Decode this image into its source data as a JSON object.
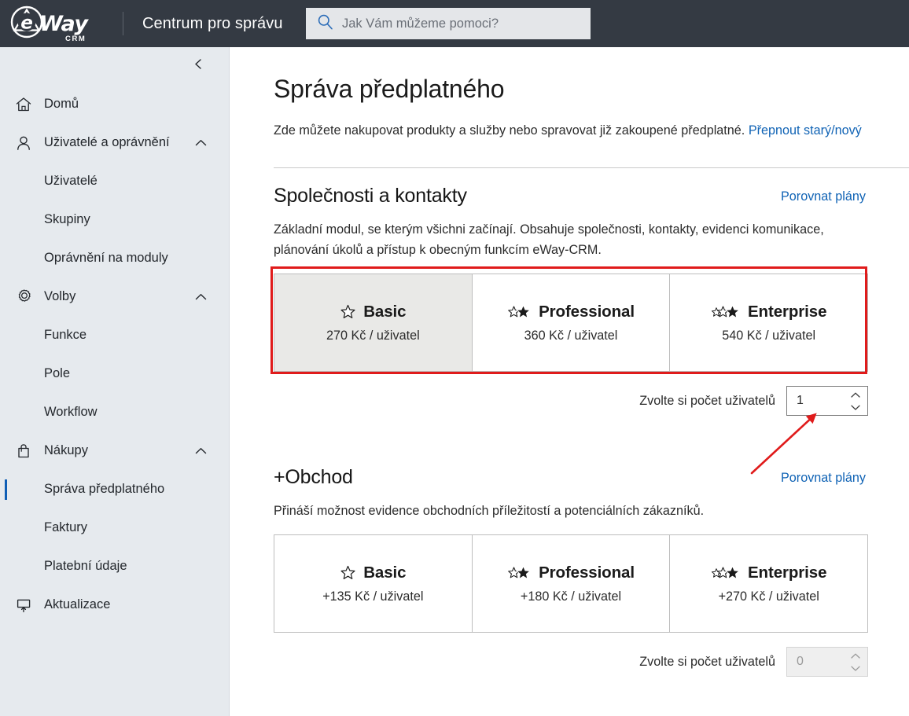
{
  "header": {
    "logo_way": "Way",
    "logo_crm": "CRM",
    "logo_emblem_icon": "eway-circle-e-icon",
    "title": "Centrum pro správu",
    "search": {
      "icon": "search-icon",
      "placeholder": "Jak Vám můžeme pomoci?",
      "value": ""
    }
  },
  "sidebar": {
    "collapse_icon": "chevron-left-icon",
    "items": [
      {
        "label": "Domů",
        "icon": "home-icon",
        "type": "top",
        "expandable": false
      },
      {
        "label": "Uživatelé a oprávnění",
        "icon": "user-icon",
        "type": "top",
        "expandable": true,
        "chevron": "chevron-up-icon"
      },
      {
        "label": "Uživatelé",
        "type": "sub"
      },
      {
        "label": "Skupiny",
        "type": "sub"
      },
      {
        "label": "Oprávnění na moduly",
        "type": "sub"
      },
      {
        "label": "Volby",
        "icon": "gear-icon",
        "type": "top",
        "expandable": true,
        "chevron": "chevron-up-icon"
      },
      {
        "label": "Funkce",
        "type": "sub"
      },
      {
        "label": "Pole",
        "type": "sub"
      },
      {
        "label": "Workflow",
        "type": "sub"
      },
      {
        "label": "Nákupy",
        "icon": "bag-icon",
        "type": "top",
        "expandable": true,
        "chevron": "chevron-up-icon"
      },
      {
        "label": "Správa předplatného",
        "type": "sub",
        "active": true
      },
      {
        "label": "Faktury",
        "type": "sub"
      },
      {
        "label": "Platební údaje",
        "type": "sub"
      },
      {
        "label": "Aktualizace",
        "icon": "monitor-upload-icon",
        "type": "top",
        "expandable": false
      }
    ]
  },
  "main": {
    "page_title": "Správa předplatného",
    "subtitle_text": "Zde můžete nakupovat produkty a služby nebo spravovat již zakoupené předplatné.",
    "subtitle_link": "Přepnout starý/nový",
    "sections": [
      {
        "title": "Společnosti a kontakty",
        "compare_link": "Porovnat plány",
        "description": "Základní modul, se kterým všichni začínají. Obsahuje společnosti, kontakty, evidenci komunikace, plánování úkolů a přístup k obecným funkcím eWay-CRM.",
        "plans": [
          {
            "name": "Basic",
            "price": "270 Kč / uživatel",
            "stars_outline": 1,
            "stars_filled": 0,
            "selected": true
          },
          {
            "name": "Professional",
            "price": "360 Kč / uživatel",
            "stars_outline": 1,
            "stars_filled": 1,
            "selected": false
          },
          {
            "name": "Enterprise",
            "price": "540 Kč / uživatel",
            "stars_outline": 2,
            "stars_filled": 1,
            "selected": false
          }
        ],
        "count_label": "Zvolte si počet uživatelů",
        "count_value": "1",
        "count_disabled": false,
        "highlighted": true
      },
      {
        "title": "+Obchod",
        "compare_link": "Porovnat plány",
        "description": "Přináší možnost evidence obchodních příležitostí a potenciálních zákazníků.",
        "plans": [
          {
            "name": "Basic",
            "price": "+135 Kč / uživatel",
            "stars_outline": 1,
            "stars_filled": 0,
            "selected": false
          },
          {
            "name": "Professional",
            "price": "+180 Kč / uživatel",
            "stars_outline": 1,
            "stars_filled": 1,
            "selected": false
          },
          {
            "name": "Enterprise",
            "price": "+270 Kč / uživatel",
            "stars_outline": 2,
            "stars_filled": 1,
            "selected": false
          }
        ],
        "count_label": "Zvolte si počet uživatelů",
        "count_value": "0",
        "count_disabled": true,
        "highlighted": false
      }
    ]
  },
  "annotations": {
    "highlight_box_color": "#e01b1b",
    "arrow_color": "#e01b1b",
    "arrow_points_to": "user-count-spinner"
  },
  "colors": {
    "header_bg": "#343a43",
    "sidebar_bg": "#e6eaee",
    "accent_blue": "#1063b5",
    "active_bar": "#0f5eb5",
    "selected_card_bg": "#e9e9e7",
    "annotation_red": "#e01b1b"
  }
}
